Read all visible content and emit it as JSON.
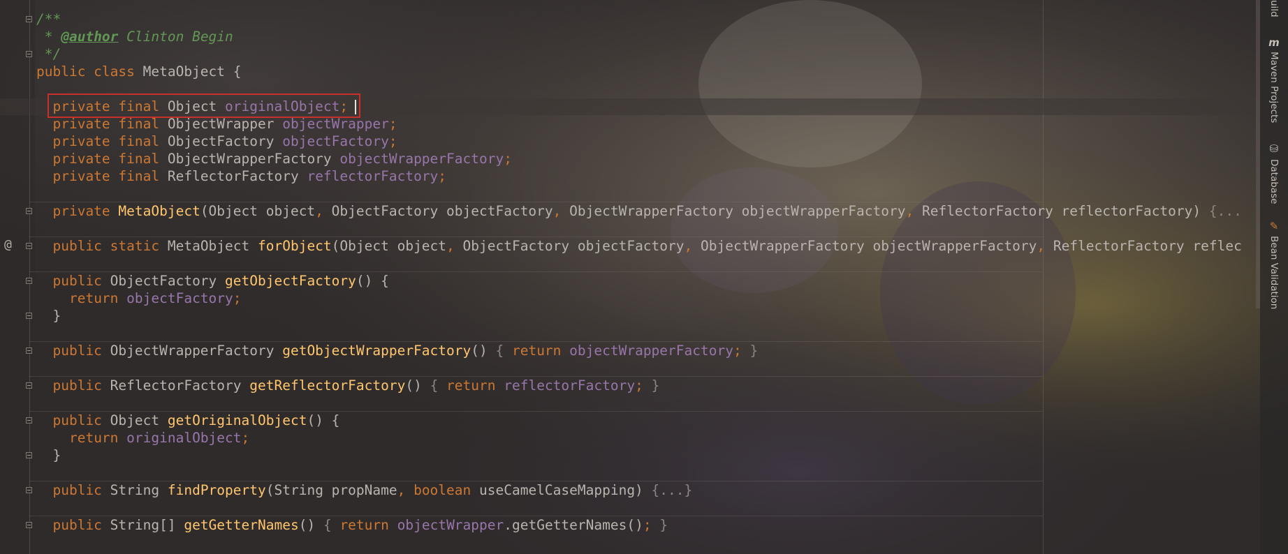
{
  "editor": {
    "lines": [
      [
        {
          "c": "cm",
          "t": "/**"
        }
      ],
      [
        {
          "c": "cm",
          "t": " * "
        },
        {
          "c": "tag",
          "t": "@author"
        },
        {
          "c": "cm",
          "t": " Clinton Begin"
        }
      ],
      [
        {
          "c": "cm",
          "t": " */"
        }
      ],
      [
        {
          "c": "kw",
          "t": "public class "
        },
        {
          "c": "pl",
          "t": "MetaObject {"
        }
      ],
      [],
      [
        {
          "c": "pl",
          "t": "  "
        },
        {
          "c": "kw",
          "t": "private final "
        },
        {
          "c": "pl",
          "t": "Object "
        },
        {
          "c": "fld",
          "t": "originalObject"
        },
        {
          "c": "pn",
          "t": ";"
        }
      ],
      [
        {
          "c": "pl",
          "t": "  "
        },
        {
          "c": "kw",
          "t": "private final "
        },
        {
          "c": "pl",
          "t": "ObjectWrapper "
        },
        {
          "c": "fld",
          "t": "objectWrapper"
        },
        {
          "c": "pn",
          "t": ";"
        }
      ],
      [
        {
          "c": "pl",
          "t": "  "
        },
        {
          "c": "kw",
          "t": "private final "
        },
        {
          "c": "pl",
          "t": "ObjectFactory "
        },
        {
          "c": "fld",
          "t": "objectFactory"
        },
        {
          "c": "pn",
          "t": ";"
        }
      ],
      [
        {
          "c": "pl",
          "t": "  "
        },
        {
          "c": "kw",
          "t": "private final "
        },
        {
          "c": "pl",
          "t": "ObjectWrapperFactory "
        },
        {
          "c": "fld",
          "t": "objectWrapperFactory"
        },
        {
          "c": "pn",
          "t": ";"
        }
      ],
      [
        {
          "c": "pl",
          "t": "  "
        },
        {
          "c": "kw",
          "t": "private final "
        },
        {
          "c": "pl",
          "t": "ReflectorFactory "
        },
        {
          "c": "fld",
          "t": "reflectorFactory"
        },
        {
          "c": "pn",
          "t": ";"
        }
      ],
      [],
      [
        {
          "c": "pl",
          "t": "  "
        },
        {
          "c": "kw",
          "t": "private "
        },
        {
          "c": "fn",
          "t": "MetaObject"
        },
        {
          "c": "pl",
          "t": "(Object object"
        },
        {
          "c": "pn",
          "t": ", "
        },
        {
          "c": "pl",
          "t": "ObjectFactory objectFactory"
        },
        {
          "c": "pn",
          "t": ", "
        },
        {
          "c": "pl",
          "t": "ObjectWrapperFactory objectWrapperFactory"
        },
        {
          "c": "pn",
          "t": ", "
        },
        {
          "c": "pl",
          "t": "ReflectorFactory reflectorFactory) "
        },
        {
          "c": "fb",
          "t": "{..."
        }
      ],
      [],
      [
        {
          "c": "pl",
          "t": "  "
        },
        {
          "c": "kw",
          "t": "public static "
        },
        {
          "c": "pl",
          "t": "MetaObject "
        },
        {
          "c": "fn",
          "t": "forObject"
        },
        {
          "c": "pl",
          "t": "(Object object"
        },
        {
          "c": "pn",
          "t": ", "
        },
        {
          "c": "pl",
          "t": "ObjectFactory objectFactory"
        },
        {
          "c": "pn",
          "t": ", "
        },
        {
          "c": "pl",
          "t": "ObjectWrapperFactory objectWrapperFactory"
        },
        {
          "c": "pn",
          "t": ", "
        },
        {
          "c": "pl",
          "t": "ReflectorFactory reflec"
        }
      ],
      [],
      [
        {
          "c": "pl",
          "t": "  "
        },
        {
          "c": "kw",
          "t": "public "
        },
        {
          "c": "pl",
          "t": "ObjectFactory "
        },
        {
          "c": "fn",
          "t": "getObjectFactory"
        },
        {
          "c": "pl",
          "t": "() {"
        }
      ],
      [
        {
          "c": "pl",
          "t": "    "
        },
        {
          "c": "kw",
          "t": "return "
        },
        {
          "c": "fld",
          "t": "objectFactory"
        },
        {
          "c": "pn",
          "t": ";"
        }
      ],
      [
        {
          "c": "pl",
          "t": "  }"
        }
      ],
      [],
      [
        {
          "c": "pl",
          "t": "  "
        },
        {
          "c": "kw",
          "t": "public "
        },
        {
          "c": "pl",
          "t": "ObjectWrapperFactory "
        },
        {
          "c": "fn",
          "t": "getObjectWrapperFactory"
        },
        {
          "c": "pl",
          "t": "() "
        },
        {
          "c": "fb",
          "t": "{ "
        },
        {
          "c": "kw",
          "t": "return "
        },
        {
          "c": "fld",
          "t": "objectWrapperFactory"
        },
        {
          "c": "pn",
          "t": ";"
        },
        {
          "c": "fb",
          "t": " }"
        }
      ],
      [],
      [
        {
          "c": "pl",
          "t": "  "
        },
        {
          "c": "kw",
          "t": "public "
        },
        {
          "c": "pl",
          "t": "ReflectorFactory "
        },
        {
          "c": "fn",
          "t": "getReflectorFactory"
        },
        {
          "c": "pl",
          "t": "() "
        },
        {
          "c": "fb",
          "t": "{ "
        },
        {
          "c": "kw",
          "t": "return "
        },
        {
          "c": "fld",
          "t": "reflectorFactory"
        },
        {
          "c": "pn",
          "t": ";"
        },
        {
          "c": "fb",
          "t": " }"
        }
      ],
      [],
      [
        {
          "c": "pl",
          "t": "  "
        },
        {
          "c": "kw",
          "t": "public "
        },
        {
          "c": "pl",
          "t": "Object "
        },
        {
          "c": "fn",
          "t": "getOriginalObject"
        },
        {
          "c": "pl",
          "t": "() {"
        }
      ],
      [
        {
          "c": "pl",
          "t": "    "
        },
        {
          "c": "kw",
          "t": "return "
        },
        {
          "c": "fld",
          "t": "originalObject"
        },
        {
          "c": "pn",
          "t": ";"
        }
      ],
      [
        {
          "c": "pl",
          "t": "  }"
        }
      ],
      [],
      [
        {
          "c": "pl",
          "t": "  "
        },
        {
          "c": "kw",
          "t": "public "
        },
        {
          "c": "pl",
          "t": "String "
        },
        {
          "c": "fn",
          "t": "findProperty"
        },
        {
          "c": "pl",
          "t": "(String propName"
        },
        {
          "c": "pn",
          "t": ", "
        },
        {
          "c": "kw",
          "t": "boolean "
        },
        {
          "c": "pl",
          "t": "useCamelCaseMapping) "
        },
        {
          "c": "fb",
          "t": "{...}"
        }
      ],
      [],
      [
        {
          "c": "pl",
          "t": "  "
        },
        {
          "c": "kw",
          "t": "public "
        },
        {
          "c": "pl",
          "t": "String[] "
        },
        {
          "c": "fn",
          "t": "getGetterNames"
        },
        {
          "c": "pl",
          "t": "() "
        },
        {
          "c": "fb",
          "t": "{ "
        },
        {
          "c": "kw",
          "t": "return "
        },
        {
          "c": "fld",
          "t": "objectWrapper"
        },
        {
          "c": "pl",
          "t": ".getGetterNames()"
        },
        {
          "c": "pn",
          "t": ";"
        },
        {
          "c": "fb",
          "t": " }"
        }
      ]
    ]
  },
  "gutter": {
    "override_marker": "@"
  },
  "tool_window": {
    "top_label": "uild",
    "maven_label": "Maven Projects",
    "maven_icon": "m-icon",
    "database_label": "Database",
    "database_icon": "database-icon",
    "bean_label": "Bean Validation",
    "bean_icon": "bean-icon"
  }
}
